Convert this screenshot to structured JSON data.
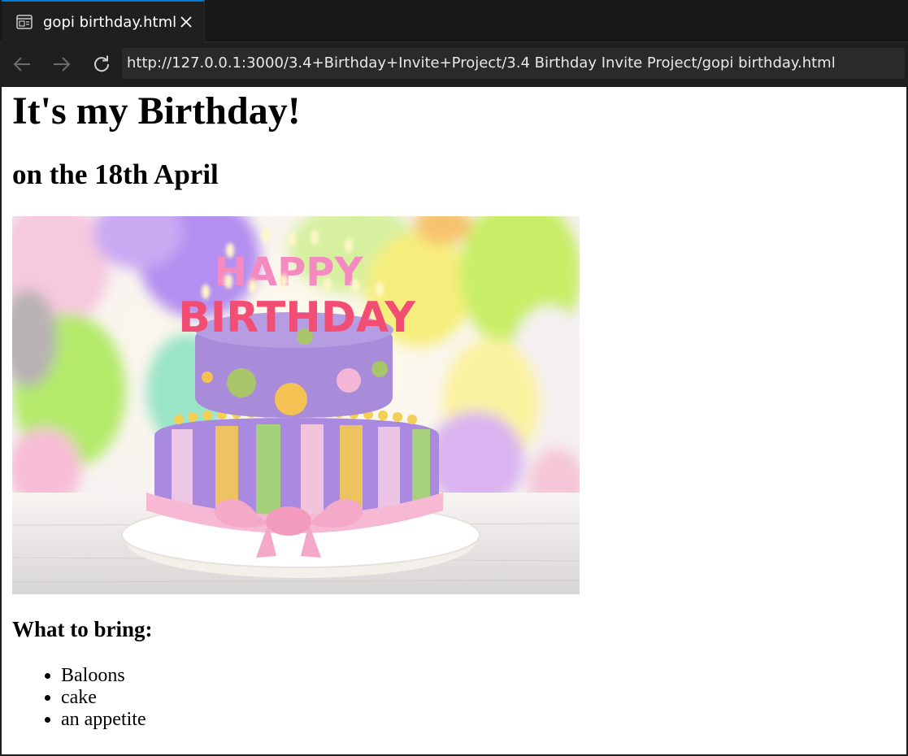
{
  "tab": {
    "title": "gopi birthday.html"
  },
  "navigation": {
    "url": "http://127.0.0.1:3000/3.4+Birthday+Invite+Project/3.4 Birthday Invite Project/gopi birthday.html"
  },
  "page": {
    "heading": "It's my Birthday!",
    "subheading": "on the 18th April",
    "image": {
      "cake_topper_line1": "HAPPY",
      "cake_topper_line2": "BIRTHDAY"
    },
    "bring_heading": "What to bring:",
    "bring_items": [
      "Baloons",
      "cake",
      "an appetite"
    ]
  },
  "colors": {
    "tab_accent": "#0078d4",
    "chrome_bg": "#1f1f1f",
    "page_bg": "#ffffff"
  }
}
